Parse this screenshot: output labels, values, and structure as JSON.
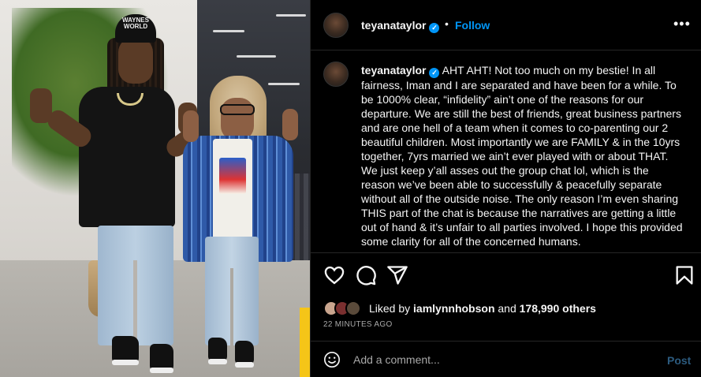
{
  "photo": {
    "cap_text": "WAYNES WORLD"
  },
  "header": {
    "username": "teyanataylor",
    "verified_icon": "verified-badge-icon",
    "separator": "•",
    "follow_label": "Follow",
    "more_icon": "more-options-icon"
  },
  "caption": {
    "username": "teyanataylor",
    "text": "AHT AHT! Not too much on my bestie! In all fairness, Iman and I are separated and have been for a while. To be 1000% clear, “infidelity” ain’t one of the reasons for our departure. We are still the best of friends, great business partners and are one hell of a team when it comes to co-parenting our 2 beautiful children. Most importantly we are FAMILY & in the 10yrs together, 7yrs married we ain’t ever played with or about THAT. We just keep y’all asses out the group chat lol, which is the reason we’ve been able to successfully & peacefully separate without all of the outside noise. The only reason I’m even sharing THIS part of the chat is because the narratives are getting a little out of hand & it’s unfair to all parties involved. I hope this provided some clarity for all of the concerned humans."
  },
  "actions": {
    "like_icon": "heart-icon",
    "comment_icon": "comment-icon",
    "share_icon": "share-icon",
    "save_icon": "bookmark-icon"
  },
  "likes": {
    "prefix": "Liked by ",
    "user": "iamlynnhobson",
    "middle": " and ",
    "count": "178,990 others"
  },
  "timestamp": "22 MINUTES AGO",
  "comment": {
    "emoji_icon": "emoji-icon",
    "placeholder": "Add a comment...",
    "post_label": "Post"
  },
  "colors": {
    "background": "#000000",
    "text": "#f5f5f5",
    "accent": "#0095f6",
    "muted": "#a8a8a8",
    "divider": "#262626"
  }
}
